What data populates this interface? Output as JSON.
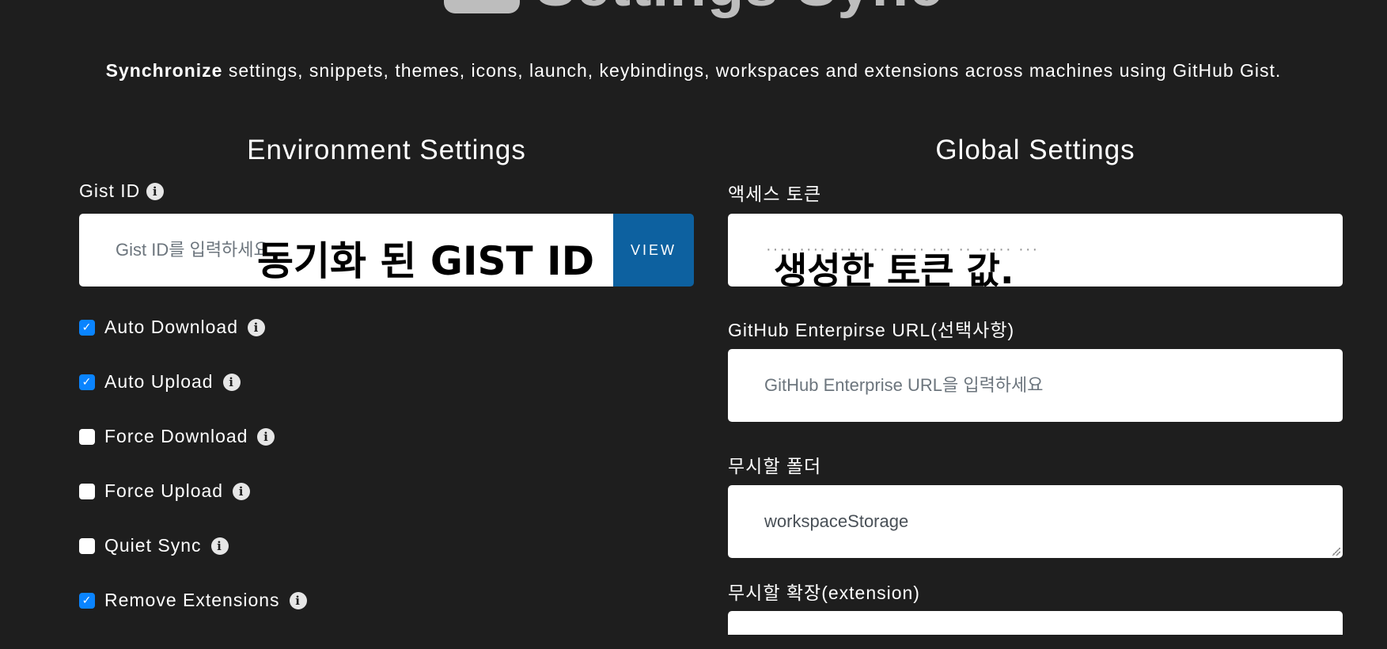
{
  "hero": {
    "title": "Settings Sync"
  },
  "subtitle": {
    "bold": "Synchronize",
    "rest": " settings, snippets, themes, icons, launch, keybindings, workspaces and extensions across machines using GitHub Gist."
  },
  "environment": {
    "title": "Environment Settings",
    "gist_label": "Gist ID",
    "gist_placeholder": "Gist ID를 입력하세요",
    "view_button": "VIEW",
    "gist_overlay": "동기화 된 GIST ID",
    "checkboxes": [
      {
        "label": "Auto Download",
        "checked": true
      },
      {
        "label": "Auto Upload",
        "checked": true
      },
      {
        "label": "Force Download",
        "checked": false
      },
      {
        "label": "Force Upload",
        "checked": false
      },
      {
        "label": "Quiet Sync",
        "checked": false
      },
      {
        "label": "Remove Extensions",
        "checked": true
      }
    ]
  },
  "global": {
    "title": "Global Settings",
    "token_label": "액세스 토큰",
    "token_overlay": "생성한 토큰 값.",
    "enterprise_label": "GitHub Enterpirse URL(선택사항)",
    "enterprise_placeholder": "GitHub Enterprise URL을 입력하세요",
    "ignore_folder_label": "무시할 폴더",
    "ignore_folder_value": "workspaceStorage",
    "ignore_ext_label": "무시할 확장(extension)"
  },
  "colors": {
    "background": "#1e1e1e",
    "view_button": "#0d61a0",
    "checkbox_checked": "#0a84ff"
  },
  "icons": {
    "info": "info-circle-icon",
    "check": "check-icon"
  }
}
